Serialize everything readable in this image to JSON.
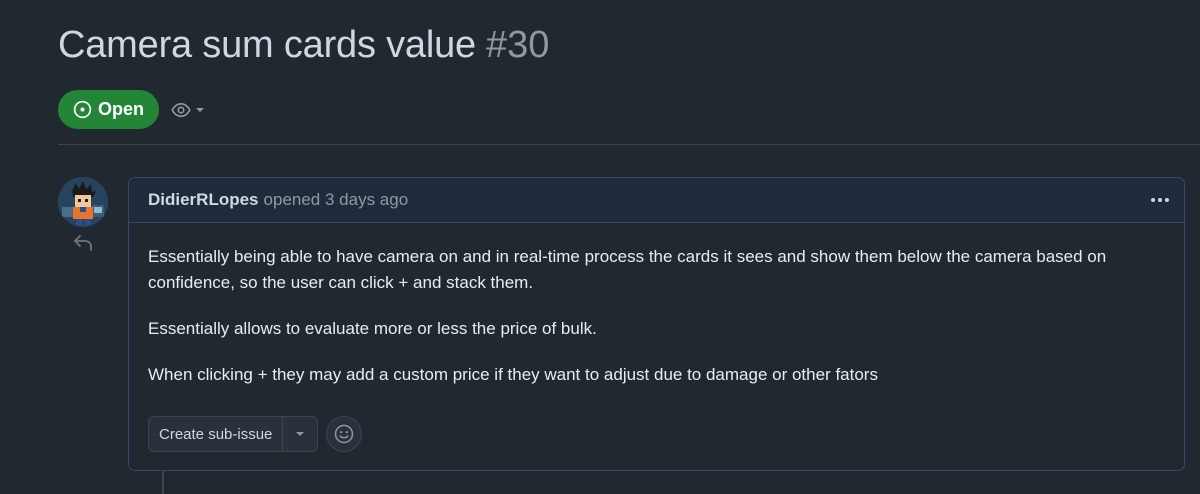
{
  "issue": {
    "title": "Camera sum cards value",
    "number": "#30",
    "state": "Open",
    "state_color": "#238636"
  },
  "watch": {
    "icon": "eye-icon"
  },
  "comment": {
    "author": "DidierRLopes",
    "meta": "opened 3 days ago",
    "paragraphs": [
      "Essentially being able to have camera on and in real-time process the cards it sees and show them below the camera based on confidence, so the user can click + and stack them.",
      "Essentially allows to evaluate more or less the price of bulk.",
      "When clicking + they may add a custom price if they want to adjust due to damage or other fators"
    ],
    "actions": {
      "create_subissue_label": "Create sub-issue",
      "emoji_icon": "smiley-icon"
    }
  },
  "colors": {
    "background": "#212830",
    "header_bg": "#1f2b3c",
    "border_accent": "#30486e"
  }
}
